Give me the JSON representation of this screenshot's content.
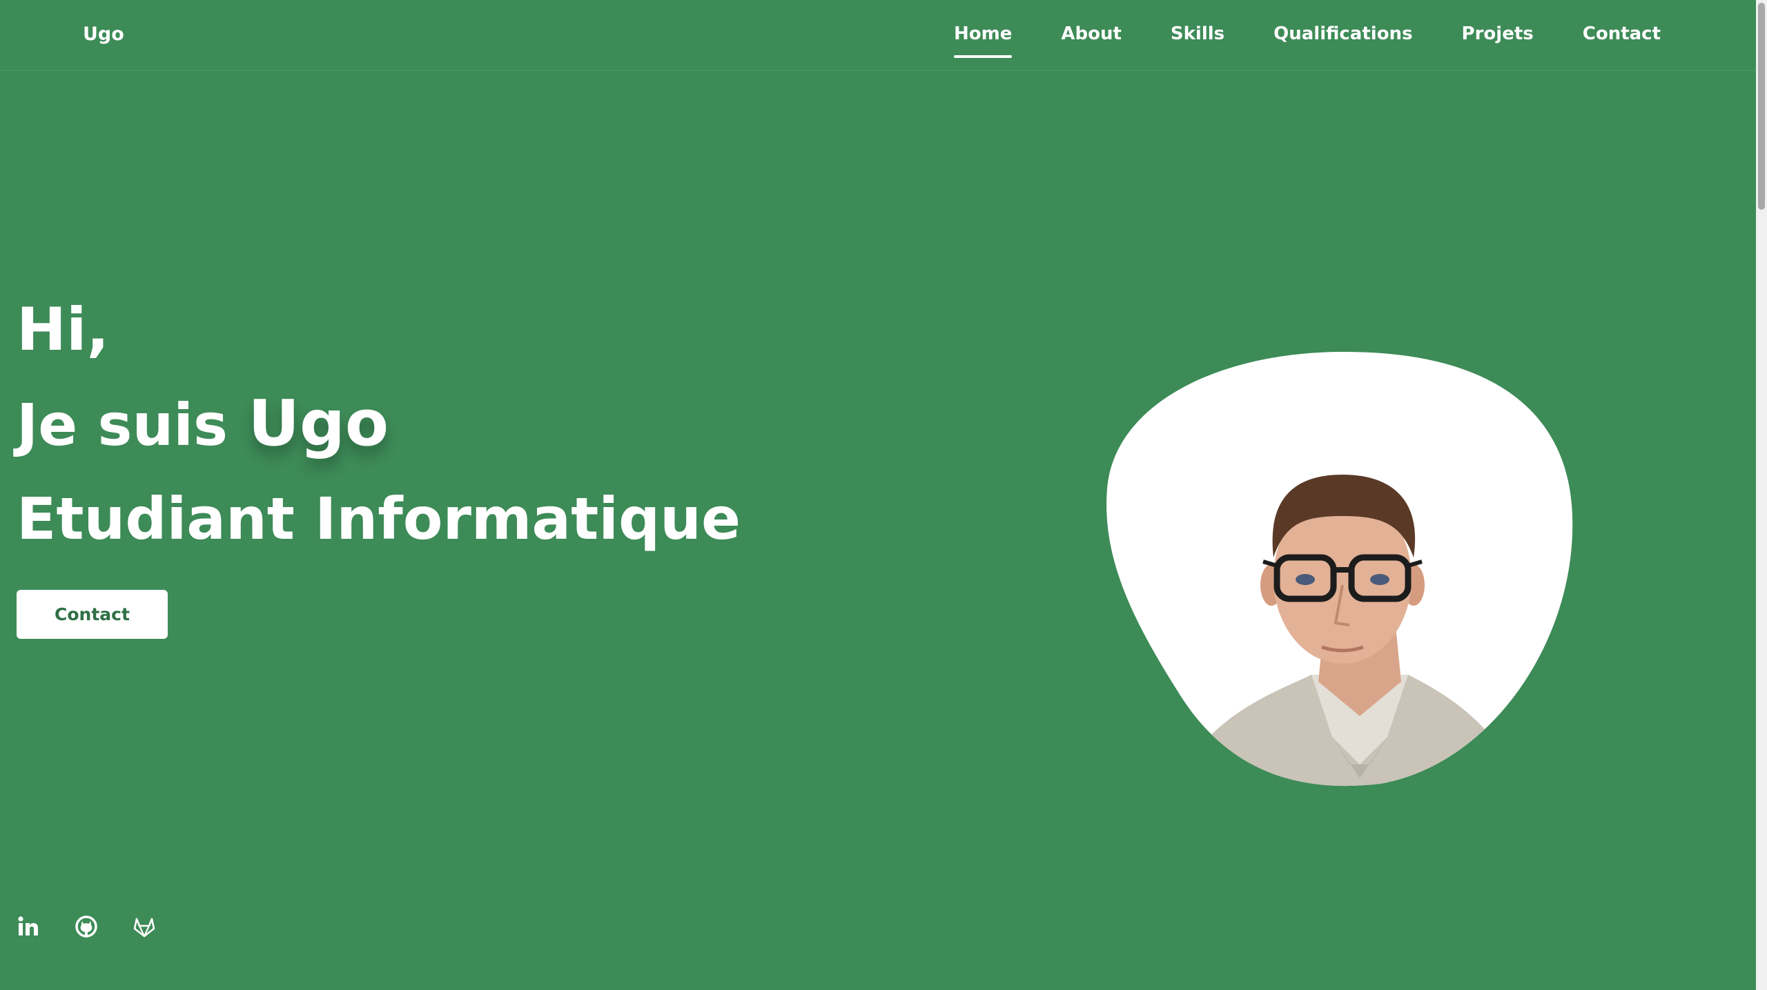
{
  "header": {
    "logo": "Ugo",
    "nav": [
      {
        "label": "Home",
        "active": true
      },
      {
        "label": "About",
        "active": false
      },
      {
        "label": "Skills",
        "active": false
      },
      {
        "label": "Qualifications",
        "active": false
      },
      {
        "label": "Projets",
        "active": false
      },
      {
        "label": "Contact",
        "active": false
      }
    ]
  },
  "hero": {
    "greeting": "Hi,",
    "intro": "Je suis",
    "name": "Ugo",
    "role": "Etudiant Informatique",
    "button_label": "Contact"
  },
  "socials": [
    {
      "icon": "linkedin-icon"
    },
    {
      "icon": "github-icon"
    },
    {
      "icon": "gitlab-icon"
    }
  ],
  "colors": {
    "background": "#3d8b57",
    "text": "#ffffff",
    "button_text": "#2f6f45"
  }
}
